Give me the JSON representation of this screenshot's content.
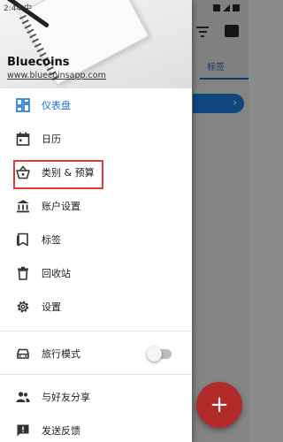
{
  "header": {
    "app_name": "Bluecoins",
    "app_url": "www.bluecoinsapp.com",
    "ghost_status": "2:44 中"
  },
  "background": {
    "tab_label": "标签",
    "card_chevron": "›",
    "fab_label": "+"
  },
  "menu": {
    "items": [
      {
        "label": "仪表盘",
        "icon": "dashboard-icon",
        "active": true
      },
      {
        "label": "日历",
        "icon": "calendar-icon"
      },
      {
        "label": "类别 & 预算",
        "icon": "basket-icon",
        "highlighted": true
      },
      {
        "label": "账户设置",
        "icon": "bank-icon"
      },
      {
        "label": "标签",
        "icon": "label-icon"
      },
      {
        "label": "回收站",
        "icon": "trash-icon"
      },
      {
        "label": "设置",
        "icon": "gear-icon"
      },
      {
        "label": "旅行模式",
        "icon": "car-icon",
        "toggle": false
      },
      {
        "label": "与好友分享",
        "icon": "people-icon"
      },
      {
        "label": "发送反馈",
        "icon": "feedback-icon"
      }
    ]
  },
  "colors": {
    "accent": "#1e6fd0",
    "highlight_border": "#e03a3a",
    "fab": "#b32a2a",
    "card": "#1976d2"
  }
}
